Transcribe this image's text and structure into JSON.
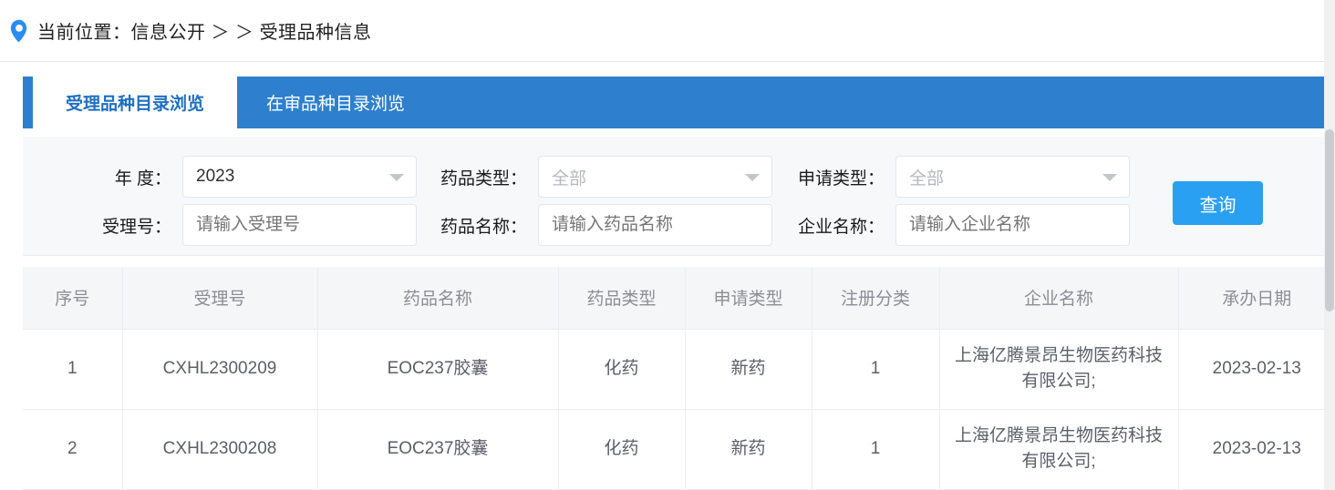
{
  "breadcrumb": {
    "icon": "location-pin-icon",
    "prefix": "当前位置：",
    "root": "信息公开",
    "separator": "＞ ＞",
    "current": "受理品种信息"
  },
  "tabs": [
    {
      "label": "受理品种目录浏览",
      "active": true
    },
    {
      "label": "在审品种目录浏览",
      "active": false
    }
  ],
  "filters": {
    "year": {
      "label": "年  度：",
      "value": "2023",
      "icon": "chevron-down-icon"
    },
    "drug_type": {
      "label": "药品类型：",
      "value": "全部",
      "icon": "chevron-down-icon"
    },
    "apply_type": {
      "label": "申请类型：",
      "value": "全部",
      "icon": "chevron-down-icon"
    },
    "accept_no": {
      "label": "受理号：",
      "placeholder": "请输入受理号",
      "value": ""
    },
    "drug_name": {
      "label": "药品名称：",
      "placeholder": "请输入药品名称",
      "value": ""
    },
    "company_name": {
      "label": "企业名称：",
      "placeholder": "请输入企业名称",
      "value": ""
    },
    "search_button": "查询"
  },
  "table": {
    "columns": [
      "序号",
      "受理号",
      "药品名称",
      "药品类型",
      "申请类型",
      "注册分类",
      "企业名称",
      "承办日期"
    ],
    "rows": [
      {
        "index": "1",
        "accept_no": "CXHL2300209",
        "drug_name": "EOC237胶囊",
        "drug_type": "化药",
        "apply_type": "新药",
        "reg_class": "1",
        "company": "上海亿腾景昂生物医药科技有限公司;",
        "date": "2023-02-13"
      },
      {
        "index": "2",
        "accept_no": "CXHL2300208",
        "drug_name": "EOC237胶囊",
        "drug_type": "化药",
        "apply_type": "新药",
        "reg_class": "1",
        "company": "上海亿腾景昂生物医药科技有限公司;",
        "date": "2023-02-13"
      }
    ]
  },
  "colors": {
    "tab_blue": "#2e80ce",
    "active_tab_text": "#1f6fc0",
    "button_blue": "#2aa0f2",
    "panel_bg": "#f6f8fa",
    "header_bg": "#f5f6f7",
    "pin_blue": "#2b8cf0"
  }
}
